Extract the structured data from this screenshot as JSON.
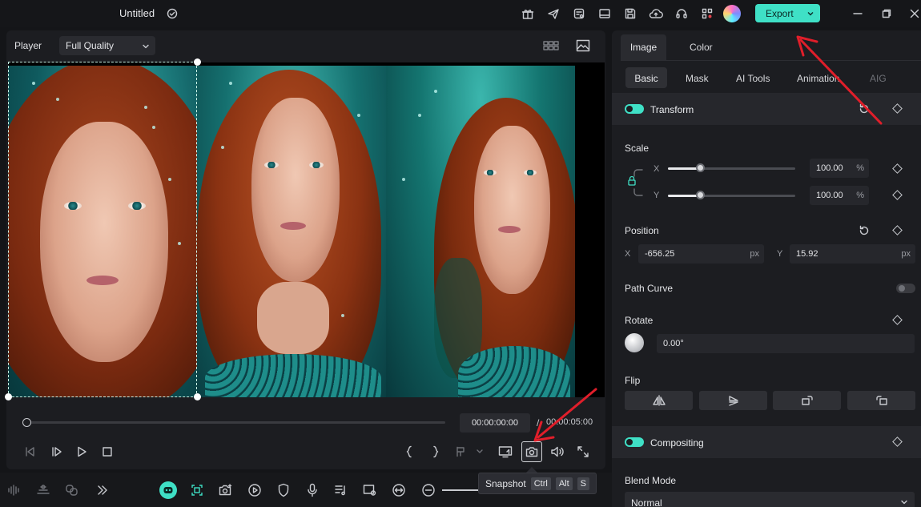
{
  "titlebar": {
    "title": "Untitled",
    "export_label": "Export"
  },
  "player": {
    "label": "Player",
    "quality": "Full Quality",
    "current_time": "00:00:00:00",
    "separator": "/",
    "total_time": "00:00:05:00",
    "progress": 0.0
  },
  "tooltip": {
    "label": "Snapshot",
    "keys": [
      "Ctrl",
      "Alt",
      "S"
    ]
  },
  "properties": {
    "tabs": [
      "Image",
      "Color"
    ],
    "subtabs": [
      "Basic",
      "Mask",
      "AI Tools",
      "Animation",
      "AIG"
    ],
    "transform": {
      "title": "Transform",
      "scale_label": "Scale",
      "scale_x_axis": "X",
      "scale_x_value": "100.00",
      "scale_y_axis": "Y",
      "scale_y_value": "100.00",
      "scale_unit": "%",
      "scale_x_level": 0.26,
      "scale_y_level": 0.26,
      "position_label": "Position",
      "position_x_axis": "X",
      "position_x_value": "-656.25",
      "position_y_axis": "Y",
      "position_y_value": "15.92",
      "position_unit": "px",
      "path_curve_label": "Path Curve",
      "rotate_label": "Rotate",
      "rotate_value": "0.00°",
      "flip_label": "Flip"
    },
    "compositing": {
      "title": "Compositing",
      "blend_mode_label": "Blend Mode",
      "blend_mode_value": "Normal"
    }
  },
  "colors": {
    "accent": "#3fe0c6",
    "annotation_arrow": "#e01e2a"
  }
}
